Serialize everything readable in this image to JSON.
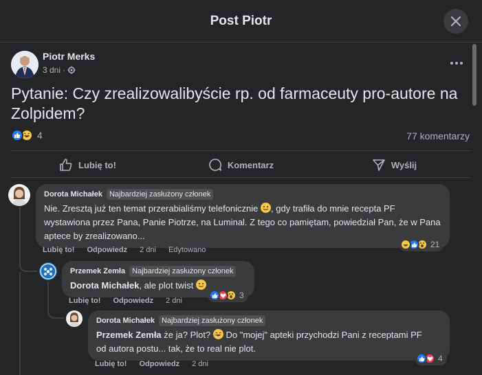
{
  "header": {
    "title": "Post Piotr",
    "close_icon": "close-icon"
  },
  "post": {
    "author": "Piotr Merks",
    "time": "3 dni",
    "audience_icon": "gear-icon",
    "more_icon": "more-horizontal-icon",
    "text": "Pytanie: Czy zrealizowalibyście rp. od farmaceuty pro-autore na Zolpidem?",
    "reaction_icons": [
      "like-icon",
      "haha-icon"
    ],
    "reaction_count": "4",
    "comments_count": "77 komentarzy"
  },
  "actions": {
    "like": "Lubię to!",
    "comment": "Komentarz",
    "share": "Wyślij"
  },
  "colors": {
    "like_blue": "#2078f4",
    "love_red": "#f33e58",
    "emoji_yellow": "#f7c844",
    "bubble_bg": "#3a3b3c",
    "modal_bg": "#242526"
  },
  "comments": [
    {
      "author": "Dorota Michałek",
      "badge": "Najbardziej zasłużony członek",
      "text": "Nie. Zresztą już ten temat przerabialiśmy telefonicznie",
      "text_after_emoji": ", gdy trafiła do mnie recepta PF wystawiona przez Pana, Panie Piotrze, na Luminal. Z tego co pamiętam, powiedział Pan, że w Pana aptece by zrealizowano...",
      "like": "Lubię to!",
      "reply": "Odpowiedz",
      "time": "2 dni",
      "edited": "Edytowano",
      "reaction_icons": [
        "haha-icon",
        "like-icon",
        "wow-icon"
      ],
      "reaction_count": "21"
    },
    {
      "author": "Przemek Zemła",
      "badge": "Najbardziej zasłużony członek",
      "mention": "Dorota Michałek",
      "text": ", ale plot twist",
      "like": "Lubię to!",
      "reply": "Odpowiedz",
      "time": "2 dni",
      "reaction_icons": [
        "like-icon",
        "love-icon",
        "wow-icon"
      ],
      "reaction_count": "3"
    },
    {
      "author": "Dorota Michałek",
      "badge": "Najbardziej zasłużony członek",
      "mention": "Przemek Zemła",
      "text_1": "że ja? Plot?",
      "text_2": "Do \"mojej\" apteki przychodzi Pani z receptami PF",
      "text_3": "od autora postu... tak, że to real nie plot.",
      "like": "Lubię to!",
      "reply": "Odpowiedz",
      "time": "2 dni",
      "reaction_icons": [
        "like-icon",
        "love-icon"
      ],
      "reaction_count": "4"
    }
  ]
}
